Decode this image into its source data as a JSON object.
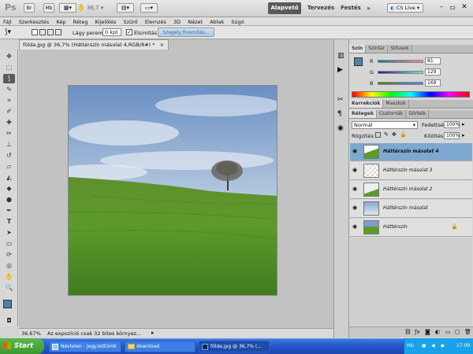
{
  "app": {
    "logo": "Ps",
    "zoom": "36,7",
    "workspaces": [
      "Alapvető",
      "Tervezés",
      "Festés"
    ],
    "more": "»",
    "cslive": "CS Live"
  },
  "menu": [
    "Fájl",
    "Szerkesztés",
    "Kép",
    "Réteg",
    "Kijelölés",
    "Szűrő",
    "Elemzés",
    "3D",
    "Nézet",
    "Ablak",
    "Súgó"
  ],
  "options": {
    "feather_label": "Lágy perem:",
    "feather_value": "0 kpt",
    "antialias_label": "Élsimítás",
    "refine_button": "Szegély finomítás..."
  },
  "document": {
    "tab_title": "földa.jpg @ 36,7% (Háttérszín másolat 4,RGB/8#) *",
    "close": "×"
  },
  "status": {
    "zoom": "36,67%",
    "message": "Az expozíció csak 32 bites környez..."
  },
  "color_panel": {
    "tabs": [
      "Szín",
      "Színtár",
      "Stílusok"
    ],
    "channels": [
      {
        "label": "R",
        "value": "81"
      },
      {
        "label": "G",
        "value": "129"
      },
      {
        "label": "B",
        "value": "169"
      }
    ],
    "fg_color": "#5181a9"
  },
  "adjust_panel": {
    "tabs": [
      "Korrekciók",
      "Maszkok"
    ]
  },
  "layers_panel": {
    "tabs": [
      "Rétegek",
      "Csatornák",
      "Görbék"
    ],
    "blend_mode": "Normál",
    "opacity_label": "Fedettség:",
    "opacity_value": "100%",
    "lock_label": "Rögzítés:",
    "fill_label": "Kitöltés:",
    "fill_value": "100%",
    "layers": [
      {
        "name": "Háttérszín másolat 4",
        "selected": true,
        "thumb": "mixed"
      },
      {
        "name": "Háttérszín másolat 3",
        "selected": false,
        "thumb": "transparent-hill"
      },
      {
        "name": "Háttérszín másolat 2",
        "selected": false,
        "thumb": "transparent-hill"
      },
      {
        "name": "Háttérszín másolat",
        "selected": false,
        "thumb": "sky"
      },
      {
        "name": "Háttérszín",
        "selected": false,
        "thumb": "full",
        "locked": true
      }
    ]
  },
  "taskbar": {
    "start": "Start",
    "tasks": [
      {
        "label": "Névtelen - Jegyzettömb",
        "active": false
      },
      {
        "label": "download",
        "active": false
      },
      {
        "label": "földa.jpg @ 36,7% (...",
        "active": true
      }
    ],
    "lang": "HU",
    "time": "17:09"
  }
}
